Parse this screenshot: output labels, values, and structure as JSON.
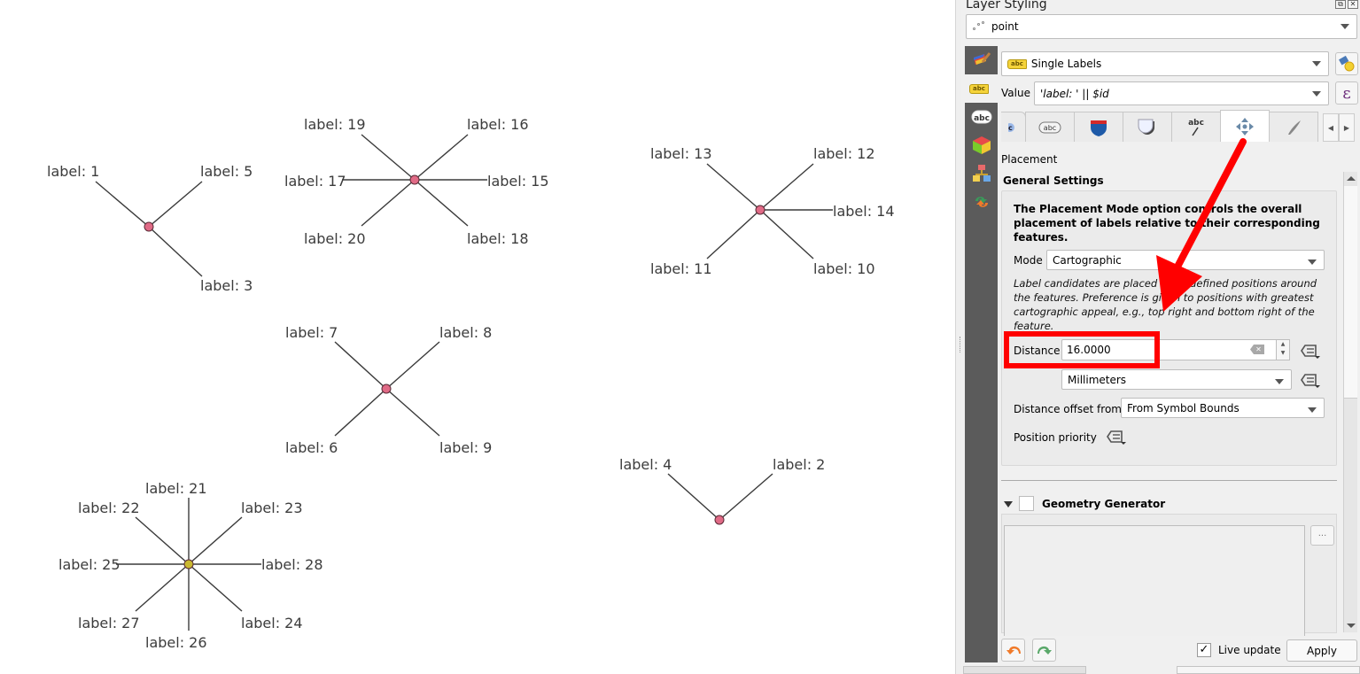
{
  "map": {
    "label_color": "#3c3c3c",
    "marker_color": "#e06a86",
    "marker_color_cluster": "#c9b830",
    "features": [
      {
        "id": "group-a",
        "labels": [
          "label: 1",
          "label: 5",
          "label: 3"
        ]
      },
      {
        "id": "group-b",
        "labels": [
          "label: 19",
          "label: 16",
          "label: 17",
          "label: 15",
          "label: 20",
          "label: 18"
        ]
      },
      {
        "id": "group-c",
        "labels": [
          "label: 13",
          "label: 12",
          "label: 14",
          "label: 11",
          "label: 10"
        ]
      },
      {
        "id": "group-d",
        "labels": [
          "label: 7",
          "label: 8",
          "label: 6",
          "label: 9"
        ]
      },
      {
        "id": "group-e",
        "labels": [
          "label: 4",
          "label: 2"
        ]
      },
      {
        "id": "group-f",
        "labels": [
          "label: 21",
          "label: 22",
          "label: 23",
          "label: 25",
          "label: 28",
          "label: 27",
          "label: 24",
          "label: 26"
        ]
      }
    ]
  },
  "panel": {
    "title": "Layer Styling",
    "dock_float": "⧉",
    "dock_close": "✕",
    "layer": "point",
    "renderer": "Single Labels",
    "renderer_badge": "abc",
    "value_label": "Value",
    "value_expression": "'label: '  ||  $id",
    "expression_symbol": "ε",
    "side_tabs": [
      "symbology",
      "labels",
      "masks",
      "3d-view",
      "diagrams",
      "history"
    ],
    "label_tabs": [
      "text",
      "formatting",
      "buffer",
      "background",
      "shadow",
      "callouts",
      "placement",
      "rendering"
    ],
    "active_tab": "placement",
    "section_label": "Placement",
    "general_settings_title": "General Settings",
    "general_description": "The Placement Mode option controls the overall placement of labels relative to their corresponding features.",
    "mode_label": "Mode",
    "mode_value": "Cartographic",
    "mode_help": "Label candidates are placed in predefined positions around the features. Preference is given to positions with greatest cartographic appeal, e.g., top right and bottom right of the feature.",
    "distance_label": "Distance",
    "distance_value": "16.0000",
    "distance_units": "Millimeters",
    "offset_from_label": "Distance offset from",
    "offset_from_value": "From Symbol Bounds",
    "position_priority_label": "Position priority",
    "geometry_generator_title": "Geometry Generator",
    "geometry_generator_enabled": false,
    "geometry_expression": "",
    "ellipsis_label": "...",
    "live_update_label": "Live update",
    "live_update_checked": true,
    "apply_label": "Apply"
  },
  "annotation": {
    "color": "#ff0000",
    "highlight": "distance-field",
    "arrow_from": "placement-tab",
    "arrow_to": "distance-field"
  }
}
